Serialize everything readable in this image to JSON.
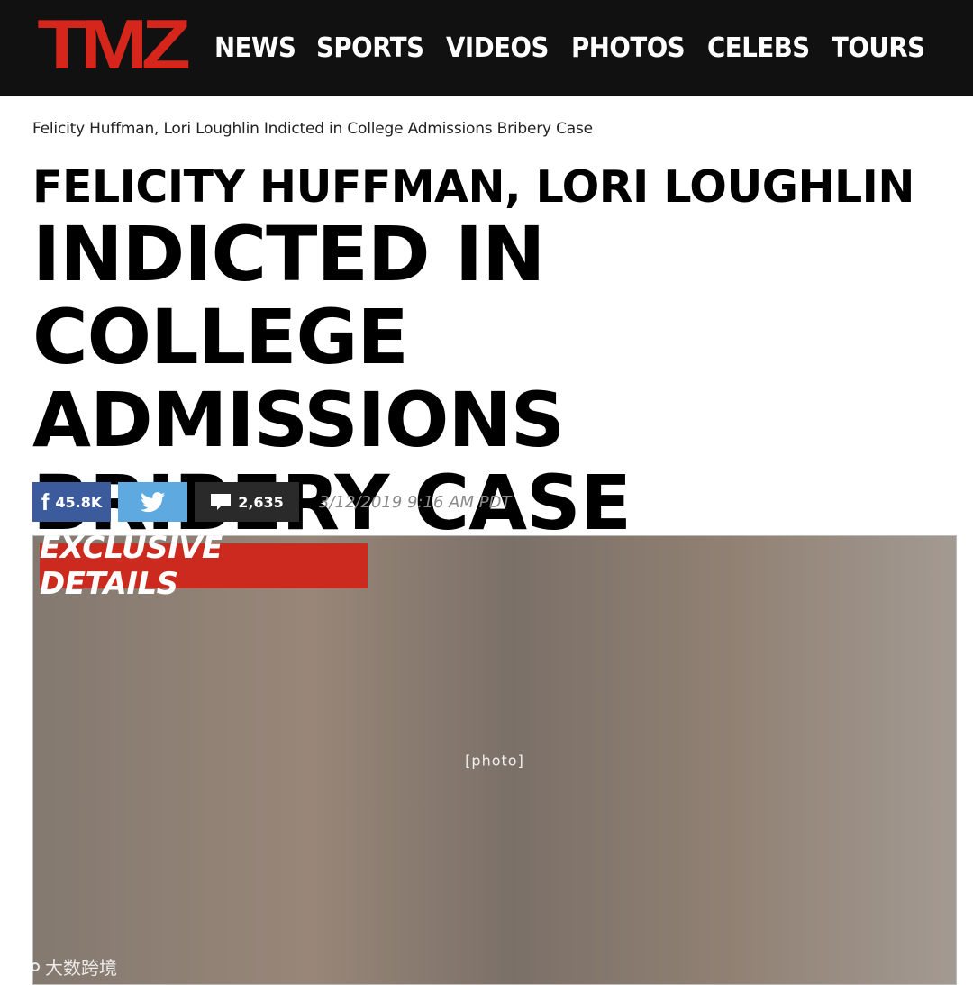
{
  "brand": {
    "logo_text": "TMZ"
  },
  "nav": {
    "items": [
      {
        "label": "NEWS"
      },
      {
        "label": "SPORTS"
      },
      {
        "label": "VIDEOS"
      },
      {
        "label": "PHOTOS"
      },
      {
        "label": "CELEBS"
      },
      {
        "label": "TOURS"
      }
    ]
  },
  "article": {
    "breadcrumb": "Felicity Huffman, Lori Loughlin Indicted in College Admissions Bribery Case",
    "kicker": "FELICITY HUFFMAN, LORI LOUGHLIN",
    "headline": "INDICTED IN COLLEGE ADMISSIONS BRIBERY CASE",
    "timestamp": "3/12/2019 9:16 AM PDT",
    "hero_badge": "EXCLUSIVE DETAILS"
  },
  "social": {
    "facebook_count": "45.8K",
    "comment_count": "2,635",
    "facebook_icon": "facebook-icon",
    "twitter_icon": "twitter-icon",
    "comment_icon": "comment-icon"
  },
  "watermark": {
    "text": "大数跨境"
  },
  "colors": {
    "topbar": "#111111",
    "brand_red": "#d6261c",
    "facebook": "#3b5b9c",
    "twitter": "#5ea9e0",
    "comments": "#2a2a2a",
    "badge": "#cc2a1f"
  }
}
